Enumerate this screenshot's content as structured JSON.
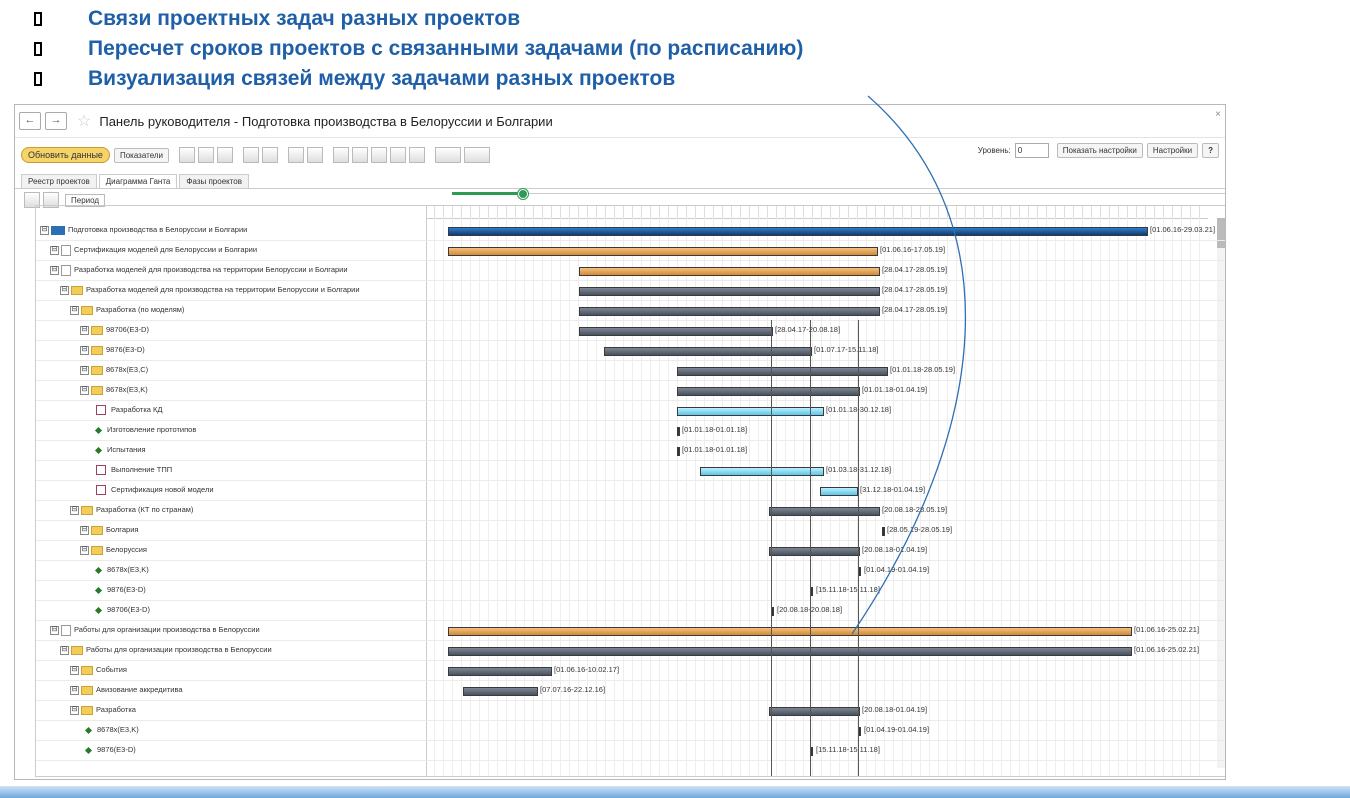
{
  "bullets": [
    "Связи проектных задач разных проектов",
    "Пересчет сроков проектов с связанными задачами (по расписанию)",
    "Визуализация связей между задачами разных проектов"
  ],
  "window": {
    "title": "Панель руководителя - Подготовка производства в Белоруссии и Болгарии",
    "close": "×"
  },
  "toolbar": {
    "refresh": "Обновить данные",
    "indicators": "Показатели",
    "level_label": "Уровень:",
    "level_value": "0",
    "show_settings": "Показать настройки",
    "settings": "Настройки",
    "help": "?"
  },
  "tabs": [
    "Реестр проектов",
    "Диаграмма Ганта",
    "Фазы проектов"
  ],
  "subbar": {
    "period": "Период"
  },
  "rows": [
    {
      "label": "Подготовка производства в Белоруссии и Болгарии",
      "range": "[01.06.16-29.03.21]",
      "icon": "project",
      "indent": 0
    },
    {
      "label": "Сертификация моделей для Белоруссии и Болгарии",
      "range": "[01.06.16-17.05.19]",
      "icon": "doc",
      "indent": 1
    },
    {
      "label": "Разработка моделей для производства на территории Белоруссии и Болгарии",
      "range": "[28.04.17-28.05.19]",
      "icon": "doc",
      "indent": 1
    },
    {
      "label": "Разработка моделей для производства на территории Белоруссии и Болгарии",
      "range": "[28.04.17-28.05.19]",
      "icon": "folder",
      "indent": 2
    },
    {
      "label": "Разработка (по моделям)",
      "range": "[28.04.17-28.05.19]",
      "icon": "folder",
      "indent": 3
    },
    {
      "label": "98706(E3-D)",
      "range": "[28.04.17-20.08.18]",
      "icon": "folder",
      "indent": 4
    },
    {
      "label": "9876(E3-D)",
      "range": "[01.07.17-15.11.18]",
      "icon": "folder",
      "indent": 4
    },
    {
      "label": "8678x(E3,C)",
      "range": "[01.01.18-28.05.19]",
      "icon": "folder",
      "indent": 4
    },
    {
      "label": "8678x(E3,K)",
      "range": "[01.01.18-01.04.19]",
      "icon": "folder",
      "indent": 4
    },
    {
      "label": "Разработка КД",
      "range": "[01.01.18-30.12.18]",
      "icon": "task",
      "indent": 5
    },
    {
      "label": "Изготовление прототипов",
      "range": "[01.01.18-01.01.18]",
      "icon": "diamond",
      "indent": 5
    },
    {
      "label": "Испытания",
      "range": "[01.01.18-01.01.18]",
      "icon": "diamond",
      "indent": 5
    },
    {
      "label": "Выполнение ТПП",
      "range": "[01.03.18-31.12.18]",
      "icon": "task",
      "indent": 5
    },
    {
      "label": "Сертификация новой модели",
      "range": "[31.12.18-01.04.19]",
      "icon": "task",
      "indent": 5
    },
    {
      "label": "Разработка (КТ по странам)",
      "range": "[20.08.18-28.05.19]",
      "icon": "folder",
      "indent": 3
    },
    {
      "label": "Болгария",
      "range": "[28.05.19-28.05.19]",
      "icon": "folder",
      "indent": 4
    },
    {
      "label": "Белоруссия",
      "range": "[20.08.18-01.04.19]",
      "icon": "folder",
      "indent": 4
    },
    {
      "label": "8678x(E3,K)",
      "range": "[01.04.19-01.04.19]",
      "icon": "diamond",
      "indent": 5
    },
    {
      "label": "9876(E3-D)",
      "range": "[15.11.18-15.11.18]",
      "icon": "diamond",
      "indent": 5
    },
    {
      "label": "98706(E3-D)",
      "range": "[20.08.18-20.08.18]",
      "icon": "diamond",
      "indent": 5
    },
    {
      "label": "Работы для организации производства в Белоруссии",
      "range": "[01.06.16-25.02.21]",
      "icon": "doc",
      "indent": 1
    },
    {
      "label": "Работы для организации производства в Белоруссии",
      "range": "[01.06.16-25.02.21]",
      "icon": "folder",
      "indent": 2
    },
    {
      "label": "События",
      "range": "[01.06.16-10.02.17]",
      "icon": "folder",
      "indent": 3
    },
    {
      "label": "Авизование аккредитива",
      "range": "[07.07.16-22.12.16]",
      "icon": "folder",
      "indent": 3
    },
    {
      "label": "Разработка",
      "range": "[20.08.18-01.04.19]",
      "icon": "folder",
      "indent": 3
    },
    {
      "label": "8678x(E3,K)",
      "range": "[01.04.19-01.04.19]",
      "icon": "diamond",
      "indent": 4
    },
    {
      "label": "9876(E3-D)",
      "range": "[15.11.18-15.11.18]",
      "icon": "diamond",
      "indent": 4
    }
  ],
  "colors": {
    "accent": "#1f5fa8",
    "milestone": "#2a7a2a",
    "refresh": "#f6d46a"
  }
}
